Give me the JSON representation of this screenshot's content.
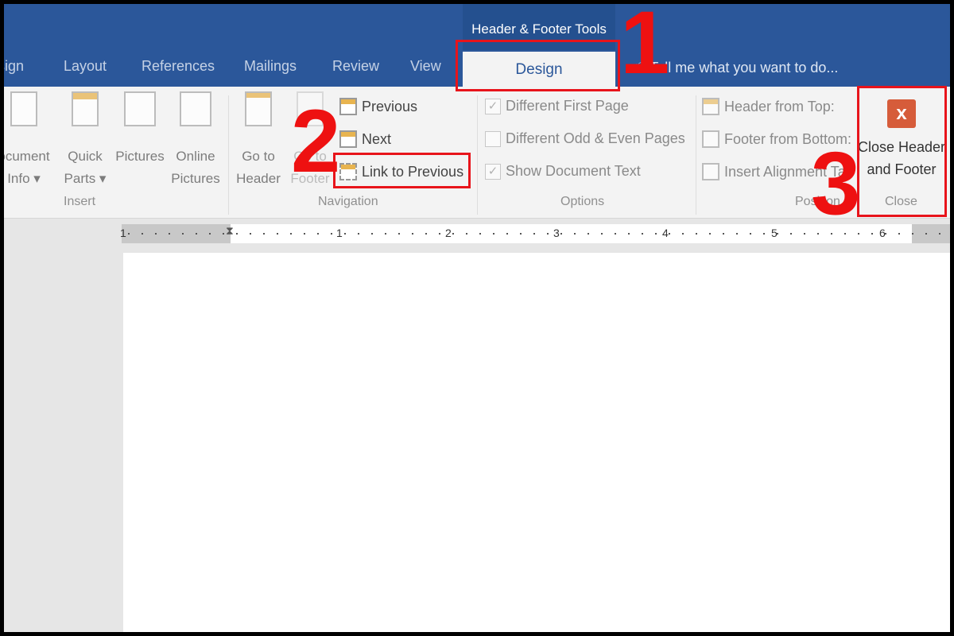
{
  "ribbon_tabs": [
    "sign",
    "Layout",
    "References",
    "Mailings",
    "Review",
    "View"
  ],
  "contextual_group": "Header & Footer Tools",
  "active_tab": "Design",
  "tell_me": "Tell me what you want to do...",
  "insert": {
    "items": [
      "Document Info",
      "Quick Parts",
      "Pictures",
      "Online Pictures"
    ],
    "doc_info_l1": "ocument",
    "doc_info_l2": "Info ▾",
    "quick_l1": "Quick",
    "quick_l2": "Parts ▾",
    "pictures": "Pictures",
    "online_l1": "Online",
    "online_l2": "Pictures",
    "label": "Insert"
  },
  "navigation": {
    "goto_header_l1": "Go to",
    "goto_header_l2": "Header",
    "goto_footer_l1": "Go to",
    "goto_footer_l2": "Footer",
    "previous": "Previous",
    "next": "Next",
    "link_to_previous": "Link to Previous",
    "label": "Navigation"
  },
  "options": {
    "items": [
      {
        "label": "Different First Page",
        "checked": true
      },
      {
        "label": "Different Odd & Even Pages",
        "checked": false
      },
      {
        "label": "Show Document Text",
        "checked": true
      }
    ],
    "label": "Options"
  },
  "position": {
    "header_from_top": "Header from Top:",
    "footer_from_bottom": "Footer from Bottom:",
    "insert_alignment_tab": "Insert Alignment Tab",
    "label": "Position"
  },
  "close": {
    "l1": "Close Header",
    "l2": "and Footer",
    "label": "Close"
  },
  "ruler": {
    "numbers": [
      "1",
      "1",
      "2",
      "3",
      "4",
      "5",
      "6"
    ]
  },
  "annotations": {
    "step1": "1",
    "step2": "2",
    "step3": "3",
    "color": "#e8141b"
  }
}
